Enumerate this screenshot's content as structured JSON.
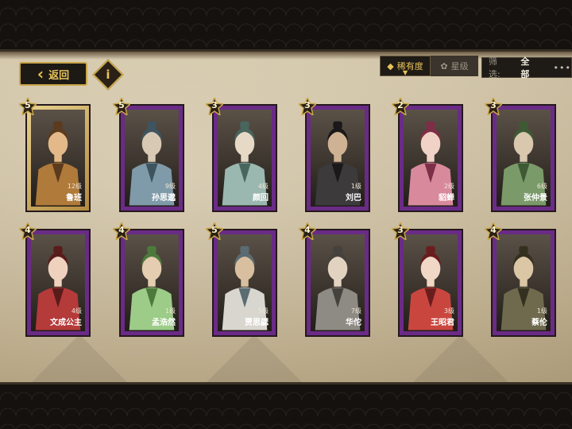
{
  "header": {
    "back_label": "返回",
    "info_icon": "i",
    "sort_rarity_label": "稀有度",
    "sort_star_label": "星级",
    "filter_label": "筛选:",
    "filter_value": "全部",
    "more_dots": "•••"
  },
  "colors": {
    "gold": "#c9a64a",
    "card_purple": "#6a2b86",
    "card_gold": "#d4b56a",
    "panel": "#cfc2a4"
  },
  "cards": [
    {
      "stars": "5",
      "level": "12级",
      "name": "鲁班",
      "frame": "gold"
    },
    {
      "stars": "5",
      "level": "9级",
      "name": "孙思邈",
      "frame": "purple"
    },
    {
      "stars": "3",
      "level": "4级",
      "name": "颜回",
      "frame": "purple"
    },
    {
      "stars": "3",
      "level": "1级",
      "name": "刘巴",
      "frame": "purple"
    },
    {
      "stars": "2",
      "level": "2级",
      "name": "貂蝉",
      "frame": "purple"
    },
    {
      "stars": "3",
      "level": "6级",
      "name": "张仲景",
      "frame": "purple"
    },
    {
      "stars": "4",
      "level": "4级",
      "name": "文成公主",
      "frame": "purple"
    },
    {
      "stars": "4",
      "level": "1级",
      "name": "孟浩然",
      "frame": "purple"
    },
    {
      "stars": "5",
      "level": "5级",
      "name": "贾思勰",
      "frame": "purple"
    },
    {
      "stars": "4",
      "level": "7级",
      "name": "华佗",
      "frame": "purple"
    },
    {
      "stars": "3",
      "level": "3级",
      "name": "王昭君",
      "frame": "purple"
    },
    {
      "stars": "4",
      "level": "1级",
      "name": "蔡伦",
      "frame": "purple"
    }
  ]
}
